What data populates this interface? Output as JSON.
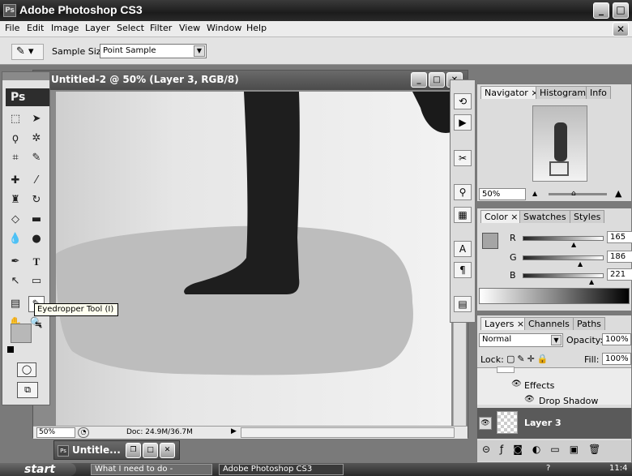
{
  "app": {
    "title": "Adobe Photoshop CS3",
    "icon_label": "Ps"
  },
  "menu": [
    "File",
    "Edit",
    "Image",
    "Layer",
    "Select",
    "Filter",
    "View",
    "Window",
    "Help"
  ],
  "options": {
    "sample_size_label": "Sample Size:",
    "sample_size_value": "Point Sample"
  },
  "toolbox": {
    "logo": "Ps",
    "tooltip": "Eyedropper Tool (I)"
  },
  "document": {
    "title": "Untitled-2 @ 50% (Layer 3, RGB/8)",
    "zoom": "50%",
    "doc_info": "Doc: 24.9M/36.7M",
    "minimized_title": "Untitle..."
  },
  "navigator": {
    "tabs": [
      "Navigator",
      "Histogram",
      "Info"
    ],
    "zoom": "50%"
  },
  "color": {
    "tabs": [
      "Color",
      "Swatches",
      "Styles"
    ],
    "r_label": "R",
    "g_label": "G",
    "b_label": "B",
    "r": "165",
    "g": "186",
    "b": "221"
  },
  "layers": {
    "tabs": [
      "Layers",
      "Channels",
      "Paths"
    ],
    "blend_mode": "Normal",
    "opacity_label": "Opacity:",
    "opacity": "100%",
    "lock_label": "Lock:",
    "fill_label": "Fill:",
    "fill": "100%",
    "effects_label": "Effects",
    "drop_shadow_label": "Drop Shadow",
    "layer_name": "Layer 3"
  },
  "taskbar": {
    "start": "start",
    "task1": "What I need to do -",
    "task2": "Adobe Photoshop CS3",
    "clock": "11:4"
  },
  "colors": {
    "titlebar": "#1c1c1c",
    "panel_bg": "#dcdcdc",
    "selected_layer": "#5a5a5a"
  }
}
